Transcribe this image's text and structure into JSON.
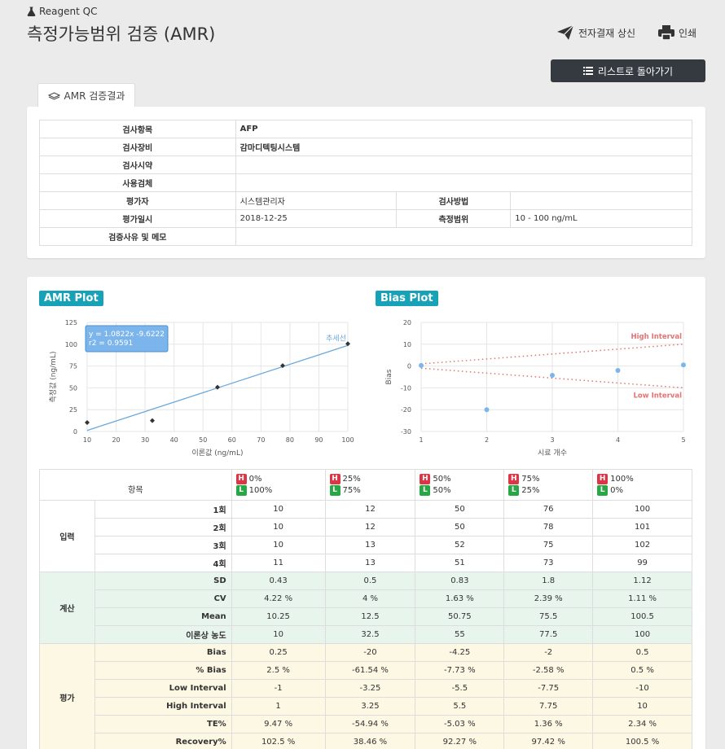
{
  "header": {
    "brand": "Reagent QC",
    "title": "측정가능범위 검증 (AMR)",
    "approval_label": "전자결재 상신",
    "print_label": "인쇄",
    "back_label": "리스트로 돌아가기"
  },
  "tab": {
    "label": "AMR 검증결과"
  },
  "info": {
    "item_label": "검사항목",
    "item_value": "AFP",
    "equip_label": "검사장비",
    "equip_value": "감마디텍팅시스템",
    "reagent_label": "검사시약",
    "reagent_value": "",
    "specimen_label": "사용검체",
    "specimen_value": "",
    "evaluator_label": "평가자",
    "evaluator_value": "시스템관리자",
    "method_label": "검사방법",
    "method_value": "",
    "date_label": "평가일시",
    "date_value": "2018-12-25",
    "range_label": "측정범위",
    "range_value": "10 - 100 ng/mL",
    "memo_label": "검증사유 및 메모",
    "memo_value": ""
  },
  "chart_data": [
    {
      "type": "scatter",
      "title": "AMR Plot",
      "xlabel": "이론값 (ng/mL)",
      "ylabel": "측정값 (ng/mL)",
      "xlim": [
        10,
        100
      ],
      "ylim": [
        0,
        125
      ],
      "xticks": [
        10,
        20,
        30,
        40,
        50,
        60,
        70,
        80,
        90,
        100
      ],
      "yticks": [
        0,
        25,
        50,
        75,
        100,
        125
      ],
      "points": [
        [
          10,
          10.25
        ],
        [
          32.5,
          12.5
        ],
        [
          55,
          50.75
        ],
        [
          77.5,
          75.5
        ],
        [
          100,
          100.5
        ]
      ],
      "trendline": {
        "label": "추세선",
        "slope": 1.0822,
        "intercept": -9.6222,
        "equation": "y = 1.0822x -9.6222",
        "r2": "r2 = 0.9591"
      },
      "grid": true
    },
    {
      "type": "scatter",
      "title": "Bias Plot",
      "xlabel": "시료 개수",
      "ylabel": "Bias",
      "xlim": [
        1,
        5
      ],
      "ylim": [
        -30,
        20
      ],
      "xticks": [
        1,
        2,
        3,
        4,
        5
      ],
      "yticks": [
        -30,
        -20,
        -10,
        0,
        10,
        20
      ],
      "points": [
        [
          1,
          0.25
        ],
        [
          2,
          -20
        ],
        [
          3,
          -4.25
        ],
        [
          4,
          -2
        ],
        [
          5,
          0.5
        ]
      ],
      "high_interval": {
        "label": "High Interval",
        "values": [
          1,
          3.25,
          5.5,
          7.75,
          10
        ]
      },
      "low_interval": {
        "label": "Low Interval",
        "values": [
          -1,
          -3.25,
          -5.5,
          -7.75,
          -10
        ]
      },
      "grid": true
    }
  ],
  "table": {
    "header_label": "항목",
    "levels": [
      {
        "h": "0%",
        "l": "100%"
      },
      {
        "h": "25%",
        "l": "75%"
      },
      {
        "h": "50%",
        "l": "50%"
      },
      {
        "h": "75%",
        "l": "25%"
      },
      {
        "h": "100%",
        "l": "0%"
      }
    ],
    "h_tag": "H",
    "l_tag": "L",
    "groups": [
      {
        "name": "입력",
        "kind": "input",
        "rows": [
          {
            "label": "1회",
            "values": [
              "10",
              "12",
              "50",
              "76",
              "100"
            ]
          },
          {
            "label": "2회",
            "values": [
              "10",
              "12",
              "50",
              "78",
              "101"
            ]
          },
          {
            "label": "3회",
            "values": [
              "10",
              "13",
              "52",
              "75",
              "102"
            ]
          },
          {
            "label": "4회",
            "values": [
              "11",
              "13",
              "51",
              "73",
              "99"
            ]
          }
        ]
      },
      {
        "name": "계산",
        "kind": "calc",
        "rows": [
          {
            "label": "SD",
            "values": [
              "0.43",
              "0.5",
              "0.83",
              "1.8",
              "1.12"
            ]
          },
          {
            "label": "CV",
            "values": [
              "4.22 %",
              "4 %",
              "1.63 %",
              "2.39 %",
              "1.11 %"
            ]
          },
          {
            "label": "Mean",
            "values": [
              "10.25",
              "12.5",
              "50.75",
              "75.5",
              "100.5"
            ]
          },
          {
            "label": "이론상 농도",
            "values": [
              "10",
              "32.5",
              "55",
              "77.5",
              "100"
            ]
          }
        ]
      },
      {
        "name": "평가",
        "kind": "eval",
        "rows": [
          {
            "label": "Bias",
            "values": [
              "0.25",
              "-20",
              "-4.25",
              "-2",
              "0.5"
            ]
          },
          {
            "label": "% Bias",
            "values": [
              "2.5 %",
              "-61.54 %",
              "-7.73 %",
              "-2.58 %",
              "0.5 %"
            ]
          },
          {
            "label": "Low Interval",
            "values": [
              "-1",
              "-3.25",
              "-5.5",
              "-7.75",
              "-10"
            ]
          },
          {
            "label": "High Interval",
            "values": [
              "1",
              "3.25",
              "5.5",
              "7.75",
              "10"
            ]
          },
          {
            "label": "TE%",
            "values": [
              "9.47 %",
              "-54.94 %",
              "-5.03 %",
              "1.36 %",
              "2.34 %"
            ]
          },
          {
            "label": "Recovery%",
            "values": [
              "102.5 %",
              "38.46 %",
              "92.27 %",
              "97.42 %",
              "100.5 %"
            ]
          }
        ]
      }
    ]
  },
  "colors": {
    "accent": "#17a2b8",
    "dark_button": "#353a40",
    "trend": "#6aa8dc",
    "interval": "#e57373",
    "point_dark": "#333333",
    "point_blue": "#7cb5ec"
  }
}
